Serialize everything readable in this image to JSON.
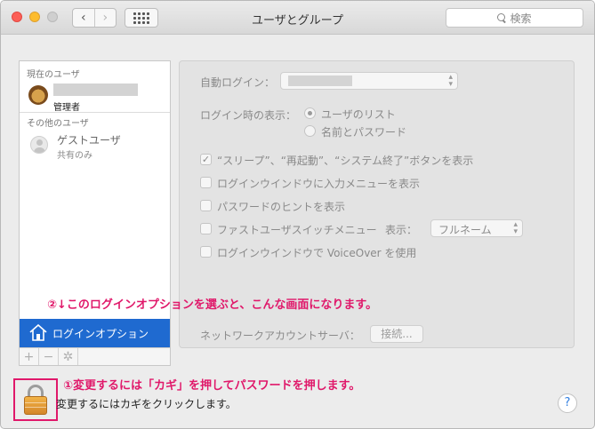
{
  "window": {
    "title": "ユーザとグループ"
  },
  "toolbar": {
    "back_glyph": "‹",
    "forward_glyph": "›",
    "search_placeholder": "検索"
  },
  "sidebar": {
    "current_users_label": "現在のユーザ",
    "current_user": {
      "role": "管理者"
    },
    "other_users_label": "その他のユーザ",
    "guest_user": {
      "name": "ゲストユーザ",
      "status": "共有のみ"
    },
    "login_options_label": "ログインオプション",
    "add_glyph": "+",
    "remove_glyph": "−",
    "settings_glyph": "✲"
  },
  "panel": {
    "auto_login_label": "自動ログイン：",
    "display_at_login_label": "ログイン時の表示：",
    "radio_user_list": "ユーザのリスト",
    "radio_name_password": "名前とパスワード",
    "check_sleep_restart": "“スリープ”、“再起動”、“システム終了”ボタンを表示",
    "check_sleep_restart_checked": true,
    "check_input_menu": "ログインウインドウに入力メニューを表示",
    "check_password_hints": "パスワードのヒントを表示",
    "check_fast_user": "ファストユーザスイッチメニュー",
    "fast_user_display_label": "表示：",
    "fast_user_display_value": "フルネーム",
    "check_voiceover": "ログインウインドウで VoiceOver を使用",
    "network_server_label": "ネットワークアカウントサーバ：",
    "join_button": "接続..."
  },
  "annotations": {
    "step2": "②↓このログインオプションを選ぶと、こんな画面になります。",
    "step1": "①変更するには「カギ」を押してパスワードを押します。",
    "color": "#e0186a"
  },
  "footer": {
    "lock_text": "変更するにはカギをクリックします。",
    "help_glyph": "?"
  }
}
